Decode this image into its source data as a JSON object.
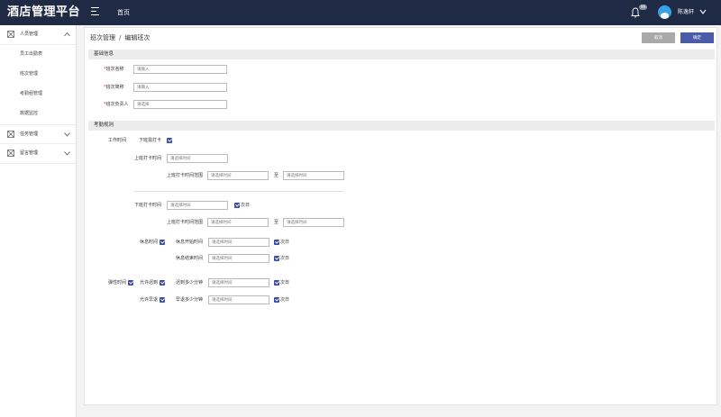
{
  "app": {
    "title": "酒店管理平台"
  },
  "topnav": {
    "home": "首页",
    "badge": "99",
    "username": "陈逸轩"
  },
  "sidebar": {
    "groups": [
      {
        "label": "人员管理",
        "expanded": true,
        "items": [
          "员工出勤表",
          "班次管理",
          "考勤组管理",
          "数据监控"
        ]
      },
      {
        "label": "任务管理",
        "expanded": false,
        "items": []
      },
      {
        "label": "留言管理",
        "expanded": false,
        "items": []
      }
    ]
  },
  "breadcrumb": {
    "parent": "班次管理",
    "sep": "/",
    "current": "编辑班次"
  },
  "actions": {
    "cancel": "取消",
    "confirm": "确定"
  },
  "basic": {
    "title": "基础信息",
    "name": {
      "label": "班次名称",
      "placeholder": "请输入"
    },
    "short": {
      "label": "班次简称",
      "placeholder": "请输入"
    },
    "owner": {
      "label": "班次负责人",
      "placeholder": "请选择"
    }
  },
  "rules": {
    "title": "考勤规则",
    "work_time": "工作时间",
    "off_clock": "下班需打卡",
    "on_time_label": "上班打卡时间",
    "on_range_label": "上班打卡时间范围",
    "off_time_label": "下班打卡时间",
    "off_range_label": "上班打卡时间范围",
    "to": "至",
    "next_day": "次日",
    "rest_time": "休息时间",
    "rest_start": "休息开始时间",
    "rest_end": "休息结束时间",
    "flex_time": "弹性时间",
    "allow_late": "允许迟到",
    "late_minutes": "迟到多少分钟",
    "allow_early": "允许早退",
    "early_minutes": "早退多少分钟",
    "time_placeholder": "请选择时间",
    "minute_placeholder": "请选择时间"
  },
  "colors": {
    "topbar": "#1f2a44",
    "accent": "#4a5ba8",
    "cancel": "#a9a9a9",
    "avatar": "#35a3e6"
  }
}
